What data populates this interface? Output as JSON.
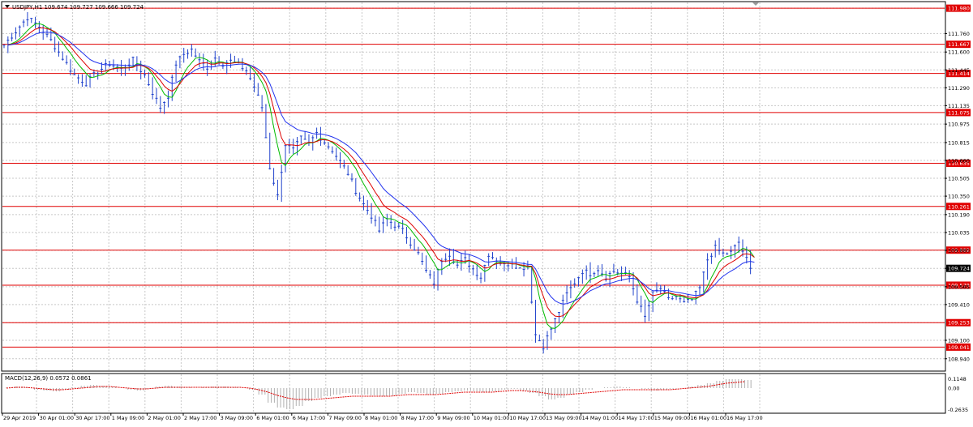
{
  "header": {
    "symbol_line": "USDJPY,H1  109.674 109.727 109.666 109.724"
  },
  "indicator": {
    "label": "MACD(12,26,9) 0.0572 0.0861"
  },
  "colors": {
    "candles": "#2244cc",
    "ma_fast": "#00bb00",
    "ma_mid": "#dd0000",
    "ma_slow": "#2233ee",
    "levels": "#e00000",
    "current_price_bg": "#000000",
    "grid": "#c8c8c8",
    "macd_hist": "#b0b0b0",
    "macd_signal": "#e00000"
  },
  "chart_data": {
    "type": "candlestick",
    "symbol": "USDJPY",
    "timeframe": "H1",
    "ylim": [
      108.84,
      112.03
    ],
    "y_ticks": [
      "111.980",
      "111.760",
      "111.600",
      "111.445",
      "111.290",
      "111.135",
      "110.975",
      "110.815",
      "110.660",
      "110.505",
      "110.350",
      "110.190",
      "110.035",
      "109.880",
      "109.724",
      "109.565",
      "109.410",
      "109.253",
      "109.100",
      "108.940"
    ],
    "levels": [
      111.98,
      111.667,
      111.414,
      111.075,
      110.635,
      110.261,
      109.882,
      109.578,
      109.253,
      109.041
    ],
    "level_labels": [
      "111.980",
      "111.667",
      "111.414",
      "111.075",
      "110.635",
      "110.261",
      "109.882",
      "109.578",
      "109.253",
      "109.041"
    ],
    "current_price": 109.724,
    "current_price_label": "109.724",
    "x_labels": [
      "29 Apr 2019",
      "30 Apr 01:00",
      "30 Apr 17:00",
      "1 May 09:00",
      "2 May 01:00",
      "2 May 17:00",
      "3 May 09:00",
      "6 May 01:00",
      "6 May 17:00",
      "7 May 09:00",
      "8 May 01:00",
      "8 May 17:00",
      "9 May 09:00",
      "10 May 01:00",
      "10 May 17:00",
      "13 May 09:00",
      "14 May 01:00",
      "14 May 17:00",
      "15 May 09:00",
      "16 May 01:00",
      "16 May 17:00"
    ],
    "close_path": [
      [
        0,
        111.66
      ],
      [
        3,
        111.78
      ],
      [
        6,
        111.9
      ],
      [
        9,
        111.82
      ],
      [
        12,
        111.7
      ],
      [
        15,
        111.55
      ],
      [
        18,
        111.4
      ],
      [
        21,
        111.33
      ],
      [
        24,
        111.43
      ],
      [
        27,
        111.5
      ],
      [
        30,
        111.45
      ],
      [
        33,
        111.53
      ],
      [
        36,
        111.4
      ],
      [
        38,
        111.25
      ],
      [
        40,
        111.12
      ],
      [
        42,
        111.22
      ],
      [
        44,
        111.5
      ],
      [
        46,
        111.58
      ],
      [
        48,
        111.62
      ],
      [
        50,
        111.52
      ],
      [
        52,
        111.47
      ],
      [
        54,
        111.55
      ],
      [
        56,
        111.5
      ],
      [
        58,
        111.52
      ],
      [
        60,
        111.49
      ],
      [
        62,
        111.44
      ],
      [
        64,
        111.3
      ],
      [
        66,
        111.12
      ],
      [
        68,
        110.6
      ],
      [
        70,
        110.35
      ],
      [
        72,
        110.8
      ],
      [
        74,
        110.75
      ],
      [
        76,
        110.85
      ],
      [
        78,
        110.8
      ],
      [
        80,
        110.9
      ],
      [
        82,
        110.82
      ],
      [
        84,
        110.75
      ],
      [
        86,
        110.65
      ],
      [
        88,
        110.55
      ],
      [
        90,
        110.4
      ],
      [
        92,
        110.28
      ],
      [
        94,
        110.18
      ],
      [
        96,
        110.05
      ],
      [
        98,
        110.15
      ],
      [
        100,
        110.1
      ],
      [
        102,
        110.05
      ],
      [
        104,
        109.95
      ],
      [
        106,
        109.85
      ],
      [
        108,
        109.7
      ],
      [
        110,
        109.6
      ],
      [
        112,
        109.8
      ],
      [
        114,
        109.85
      ],
      [
        116,
        109.75
      ],
      [
        118,
        109.8
      ],
      [
        120,
        109.72
      ],
      [
        122,
        109.65
      ],
      [
        124,
        109.85
      ],
      [
        126,
        109.8
      ],
      [
        128,
        109.75
      ],
      [
        130,
        109.78
      ],
      [
        132,
        109.72
      ],
      [
        134,
        109.75
      ],
      [
        136,
        109.15
      ],
      [
        138,
        109.05
      ],
      [
        140,
        109.2
      ],
      [
        142,
        109.35
      ],
      [
        144,
        109.5
      ],
      [
        146,
        109.6
      ],
      [
        148,
        109.7
      ],
      [
        150,
        109.68
      ],
      [
        152,
        109.72
      ],
      [
        154,
        109.65
      ],
      [
        156,
        109.7
      ],
      [
        158,
        109.68
      ],
      [
        160,
        109.65
      ],
      [
        162,
        109.45
      ],
      [
        164,
        109.3
      ],
      [
        166,
        109.5
      ],
      [
        168,
        109.55
      ],
      [
        170,
        109.45
      ],
      [
        172,
        109.48
      ],
      [
        174,
        109.42
      ],
      [
        176,
        109.45
      ],
      [
        178,
        109.55
      ],
      [
        180,
        109.8
      ],
      [
        182,
        109.9
      ],
      [
        184,
        109.85
      ],
      [
        186,
        109.86
      ],
      [
        188,
        109.95
      ],
      [
        190,
        109.8
      ],
      [
        191,
        109.724
      ]
    ],
    "macd_ylim": [
      -0.3,
      0.16
    ],
    "macd_ticks": [
      "0.1148",
      "0.00",
      "-0.2635"
    ],
    "macd_values": [
      0.01,
      0.02,
      0.01,
      -0.02,
      -0.03,
      -0.04,
      -0.02,
      0.01,
      0.03,
      0.04,
      0.03,
      0.02,
      0.0,
      -0.02,
      -0.03,
      -0.01,
      0.02,
      0.03,
      0.02,
      0.01,
      0.0,
      0.01,
      0.02,
      0.02,
      0.01,
      0.0,
      -0.02,
      -0.08,
      -0.18,
      -0.24,
      -0.26,
      -0.22,
      -0.16,
      -0.12,
      -0.1,
      -0.08,
      -0.06,
      -0.07,
      -0.08,
      -0.09,
      -0.1,
      -0.09,
      -0.07,
      -0.05,
      -0.06,
      -0.08,
      -0.07,
      -0.05,
      -0.04,
      -0.03,
      -0.04,
      -0.05,
      -0.04,
      -0.02,
      -0.01,
      -0.03,
      -0.06,
      -0.1,
      -0.14,
      -0.12,
      -0.08,
      -0.05,
      -0.02,
      0.0,
      0.01,
      0.02,
      0.01,
      0.0,
      -0.01,
      -0.03,
      -0.02,
      -0.01,
      0.0,
      0.02,
      0.04,
      0.06,
      0.09,
      0.11,
      0.11,
      0.1
    ],
    "macd_signal": [
      0.0,
      0.01,
      0.01,
      0.0,
      -0.01,
      -0.02,
      -0.02,
      -0.01,
      0.0,
      0.01,
      0.02,
      0.02,
      0.01,
      0.0,
      -0.01,
      -0.01,
      0.0,
      0.01,
      0.01,
      0.01,
      0.01,
      0.01,
      0.01,
      0.01,
      0.01,
      0.01,
      0.0,
      -0.02,
      -0.05,
      -0.09,
      -0.12,
      -0.14,
      -0.14,
      -0.14,
      -0.13,
      -0.12,
      -0.11,
      -0.1,
      -0.1,
      -0.1,
      -0.1,
      -0.1,
      -0.09,
      -0.08,
      -0.08,
      -0.08,
      -0.08,
      -0.07,
      -0.06,
      -0.05,
      -0.05,
      -0.05,
      -0.05,
      -0.04,
      -0.03,
      -0.03,
      -0.04,
      -0.05,
      -0.07,
      -0.08,
      -0.08,
      -0.07,
      -0.06,
      -0.05,
      -0.04,
      -0.03,
      -0.02,
      -0.02,
      -0.02,
      -0.02,
      -0.02,
      -0.02,
      -0.01,
      0.0,
      0.01,
      0.02,
      0.04,
      0.06,
      0.07,
      0.08
    ]
  }
}
